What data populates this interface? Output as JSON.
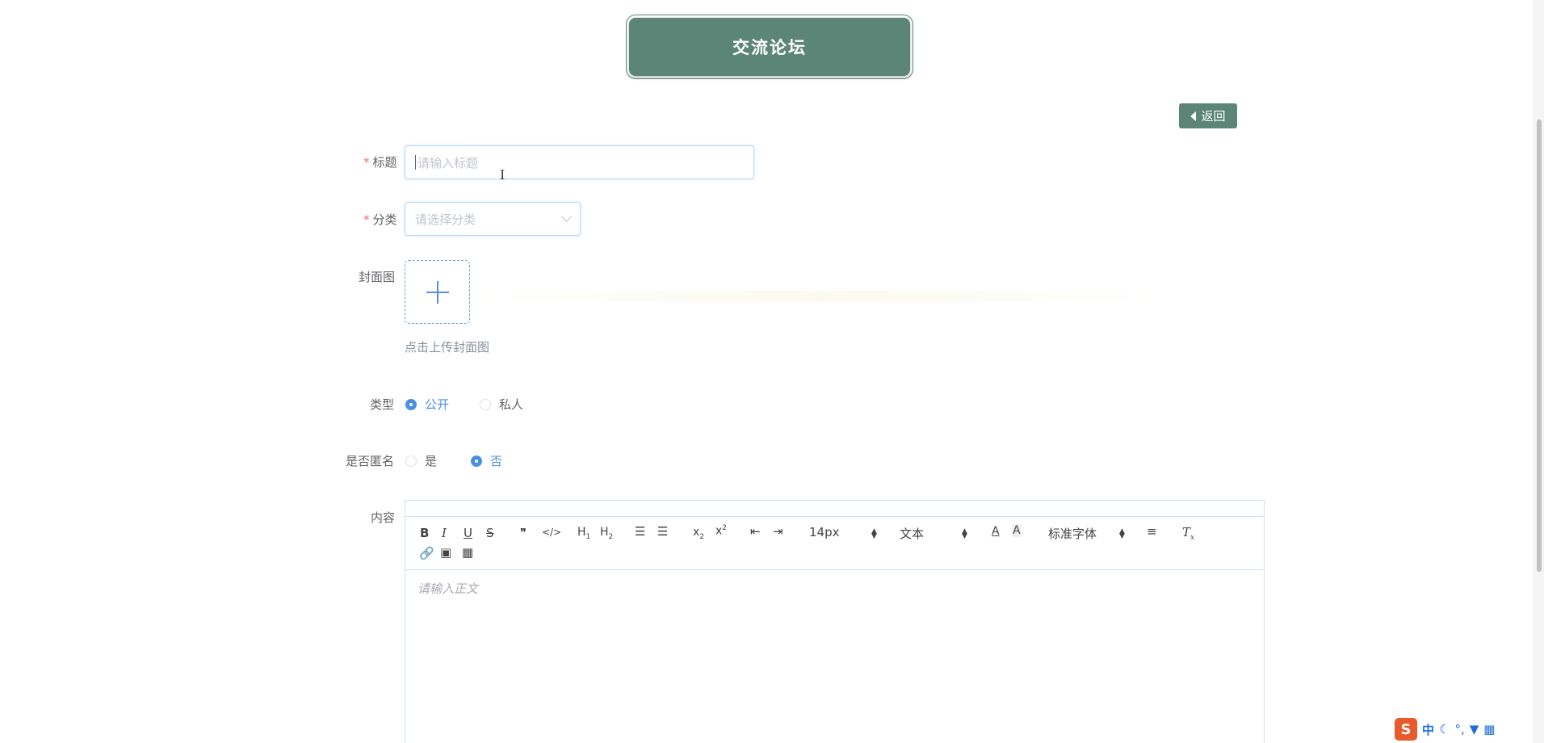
{
  "header": {
    "title": "交流论坛"
  },
  "toolbar": {
    "back_label": "返回"
  },
  "form": {
    "title": {
      "label": "标题",
      "placeholder": "请输入标题"
    },
    "category": {
      "label": "分类",
      "placeholder": "请选择分类"
    },
    "cover": {
      "label": "封面图",
      "hint": "点击上传封面图"
    },
    "type": {
      "label": "类型",
      "options": [
        "公开",
        "私人"
      ],
      "selected": "公开"
    },
    "anonymous": {
      "label": "是否匿名",
      "options": [
        "是",
        "否"
      ],
      "selected": "否"
    },
    "content": {
      "label": "内容",
      "placeholder": "请输入正文"
    },
    "required_mark": "*"
  },
  "editor": {
    "buttons": [
      "B",
      "I",
      "U",
      "S",
      "❞",
      "</>",
      "H1",
      "H2",
      "ordered-list",
      "bullet-list",
      "x2",
      "x2",
      "outdent",
      "indent"
    ],
    "size_value": "14px",
    "header_value": "文本",
    "font_value": "标准字体"
  },
  "ime": {
    "mode": "中"
  },
  "colors": {
    "brand": "#5b8576",
    "accent": "#4a90e2",
    "required": "#f56c6c"
  }
}
